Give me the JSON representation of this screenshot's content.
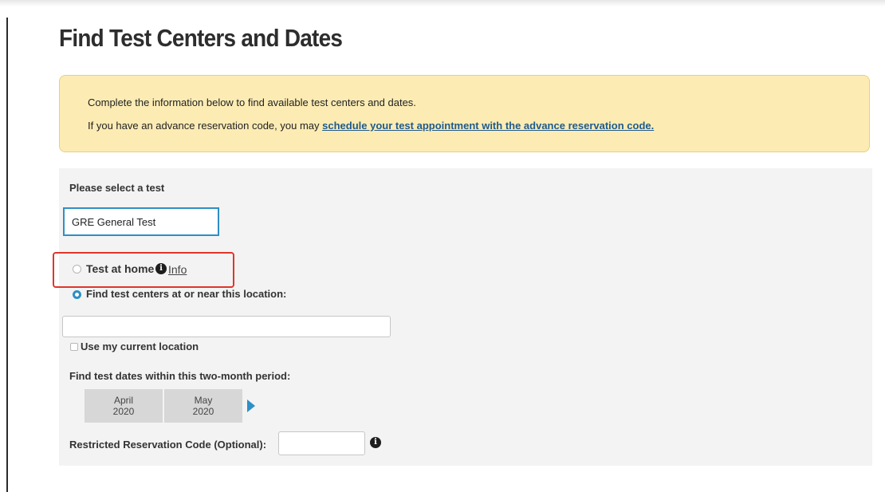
{
  "page": {
    "title": "Find Test Centers and Dates"
  },
  "notice": {
    "line1": "Complete the information below to find available test centers and dates.",
    "line2_prefix": "If you have an advance reservation code, you may ",
    "line2_link": "schedule your test appointment with the advance reservation code."
  },
  "form": {
    "select_test_label": "Please select a test",
    "selected_test": "GRE General Test",
    "option_home_label": "Test at home",
    "info_link": "Info",
    "info_icon_glyph": "i",
    "option_center_label": "Find test centers at or near this location:",
    "location_value": "",
    "use_location_label": "Use my current location",
    "period_label": "Find test dates within this two-month period:",
    "months": [
      {
        "month": "April",
        "year": "2020"
      },
      {
        "month": "May",
        "year": "2020"
      }
    ],
    "reservation_label": "Restricted Reservation Code (Optional):",
    "reservation_value": ""
  },
  "icons": {
    "info": "info-icon",
    "next": "next-arrow-icon"
  },
  "colors": {
    "accent": "#2d8fc6",
    "notice_bg": "#fcecb4",
    "highlight": "#e0352b",
    "link": "#1f5a8c"
  }
}
